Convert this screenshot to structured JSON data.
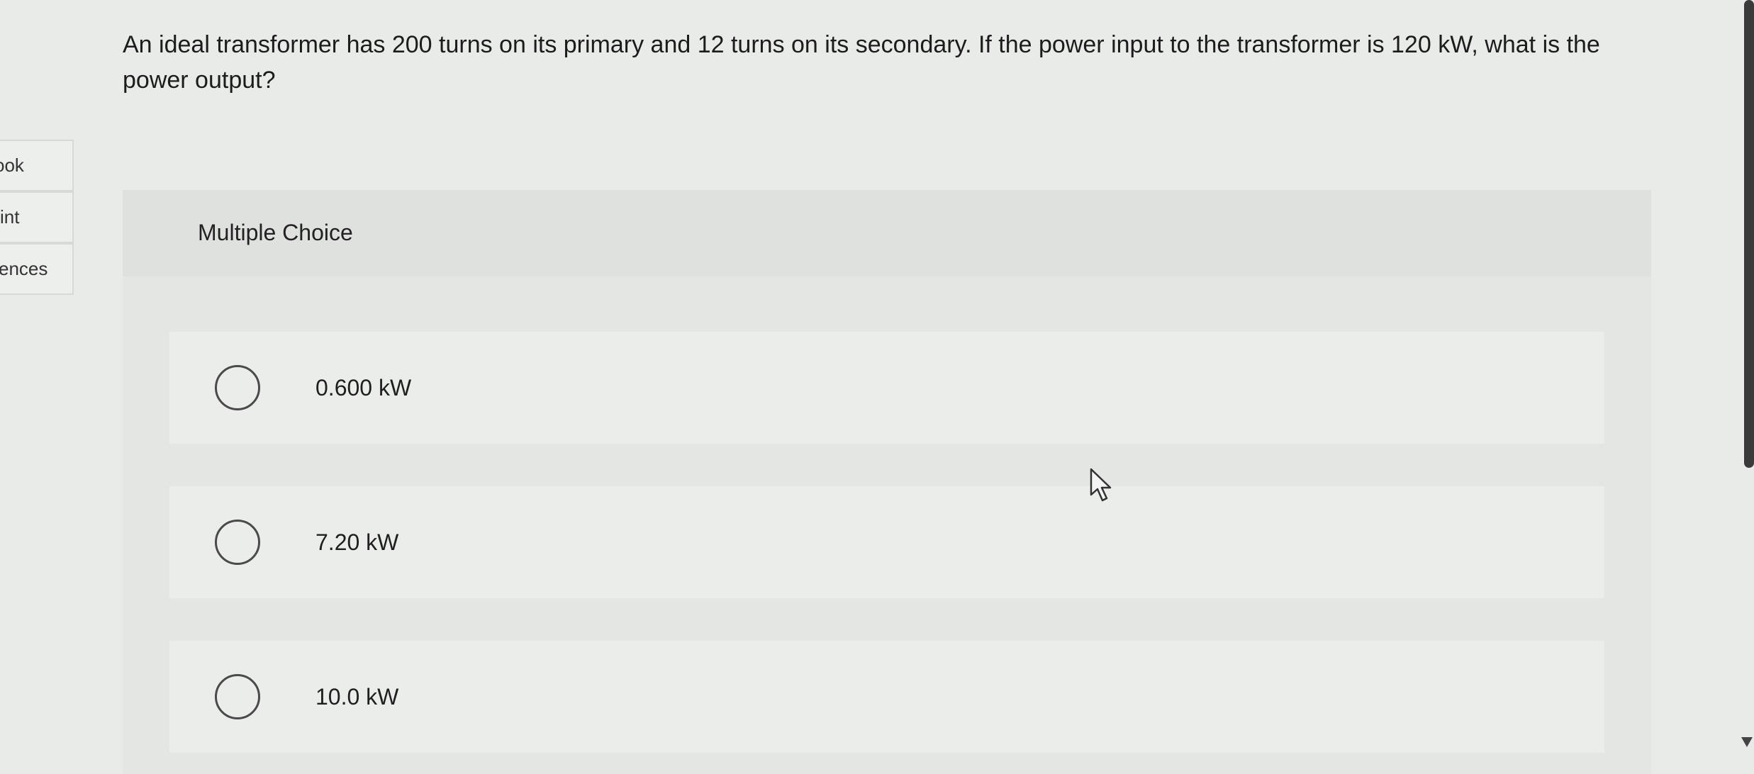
{
  "sidebar": {
    "tabs": [
      {
        "label": "ook"
      },
      {
        "label": "int"
      },
      {
        "label": "ences"
      }
    ]
  },
  "question": {
    "text": "An ideal transformer has 200 turns on its primary and 12 turns on its secondary. If the power input to the transformer is 120 kW, what is the power output?"
  },
  "multiple_choice": {
    "label": "Multiple Choice",
    "choices": [
      {
        "label": "0.600 kW"
      },
      {
        "label": "7.20 kW"
      },
      {
        "label": "10.0 kW"
      }
    ]
  },
  "icons": {
    "cursor": "arrow-cursor-icon",
    "radio": "radio-unchecked-icon"
  },
  "colors": {
    "background": "#e8ebe8",
    "panel": "#e4e6e4",
    "choice_bg": "#ebedeb",
    "scrollbar": "#3a3a3a"
  }
}
